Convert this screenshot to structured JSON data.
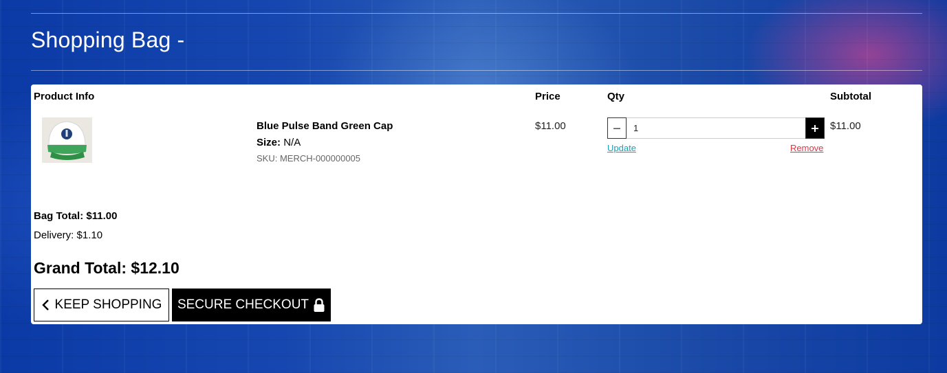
{
  "page": {
    "title": "Shopping Bag -"
  },
  "table": {
    "headers": {
      "product_info": "Product Info",
      "price": "Price",
      "qty": "Qty",
      "subtotal": "Subtotal"
    }
  },
  "item": {
    "name": "Blue Pulse Band Green Cap",
    "size_label": "Size:",
    "size_value": "N/A",
    "sku": "SKU: MERCH-000000005",
    "price": "$11.00",
    "quantity": "1",
    "subtotal": "$11.00",
    "update_label": "Update",
    "remove_label": "Remove",
    "image_icon": "green-trucker-cap-image"
  },
  "totals": {
    "bag_total": "Bag Total: $11.00",
    "delivery": "Delivery: $1.10",
    "grand_total": "Grand Total: $12.10"
  },
  "actions": {
    "keep_shopping": "KEEP SHOPPING",
    "secure_checkout": "SECURE CHECKOUT",
    "keep_icon": "chevron-left-icon",
    "checkout_icon": "lock-icon"
  },
  "colors": {
    "update_link": "#17a2b8",
    "remove_link": "#dc3545",
    "checkout_button": "#000000",
    "background_blue": "#1647b0"
  }
}
